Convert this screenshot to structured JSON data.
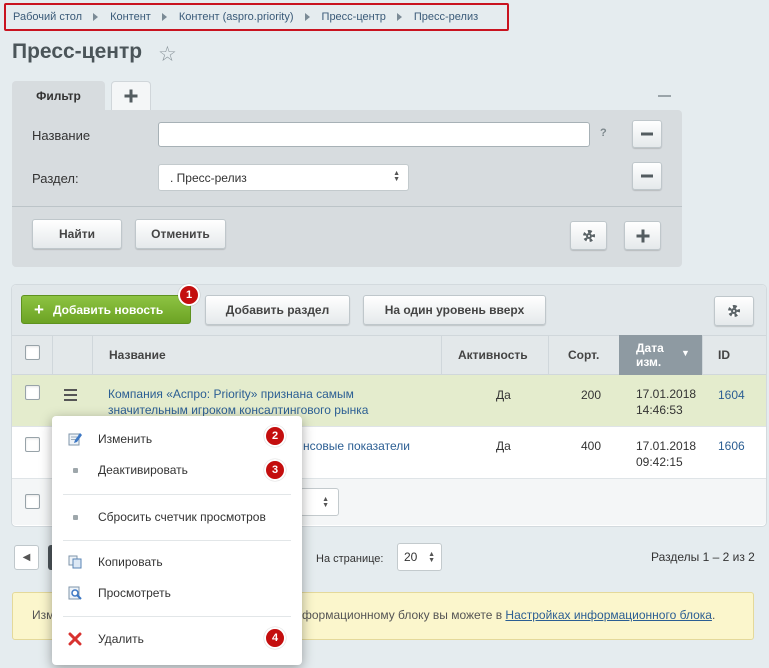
{
  "breadcrumb": [
    "Рабочий стол",
    "Контент",
    "Контент (aspro.priority)",
    "Пресс-центр",
    "Пресс-релиз"
  ],
  "page": {
    "title": "Пресс-центр"
  },
  "filter": {
    "tab_label": "Фильтр",
    "name_label": "Название",
    "name_value": "",
    "help": "?",
    "section_label": "Раздел:",
    "section_value": ". Пресс-релиз",
    "find_label": "Найти",
    "cancel_label": "Отменить"
  },
  "toolbar": {
    "add_news_label": "Добавить новость",
    "add_section_label": "Добавить раздел",
    "level_up_label": "На один уровень вверх"
  },
  "table": {
    "columns": {
      "name": "Название",
      "active": "Активность",
      "sort": "Сорт.",
      "date_line1": "Дата",
      "date_line2": "изм.",
      "id": "ID"
    },
    "rows": [
      {
        "name_line1": "Компания «Аспро: Priority» признана самым",
        "name_line2": "значительным игроком консалтингового рынка",
        "active": "Да",
        "sort": "200",
        "date_line1": "17.01.2018",
        "date_line2": "14:46:53",
        "id": "1604"
      },
      {
        "name_line1": "нсовые показатели",
        "active": "Да",
        "sort": "400",
        "date_line1": "17.01.2018",
        "date_line2": "09:42:15",
        "id": "1606"
      }
    ]
  },
  "pagination": {
    "per_page_label": "На странице:",
    "per_page_value": "20",
    "summary": "Разделы 1 – 2 из 2"
  },
  "notice": {
    "prefix": "Изм",
    "middle": "формационному блоку вы можете в",
    "link": "Настройках информационного блока",
    "suffix": "."
  },
  "context_menu": {
    "edit": "Изменить",
    "deactivate": "Деактивировать",
    "reset_counter": "Сбросить счетчик просмотров",
    "copy": "Копировать",
    "view": "Просмотреть",
    "delete": "Удалить"
  },
  "badges": [
    "1",
    "2",
    "3",
    "4"
  ],
  "colors": {
    "accent_green": "#7ab435",
    "badge_red": "#c40e0e",
    "highlight_row": "#e4eccd",
    "link": "#2b5e93"
  }
}
